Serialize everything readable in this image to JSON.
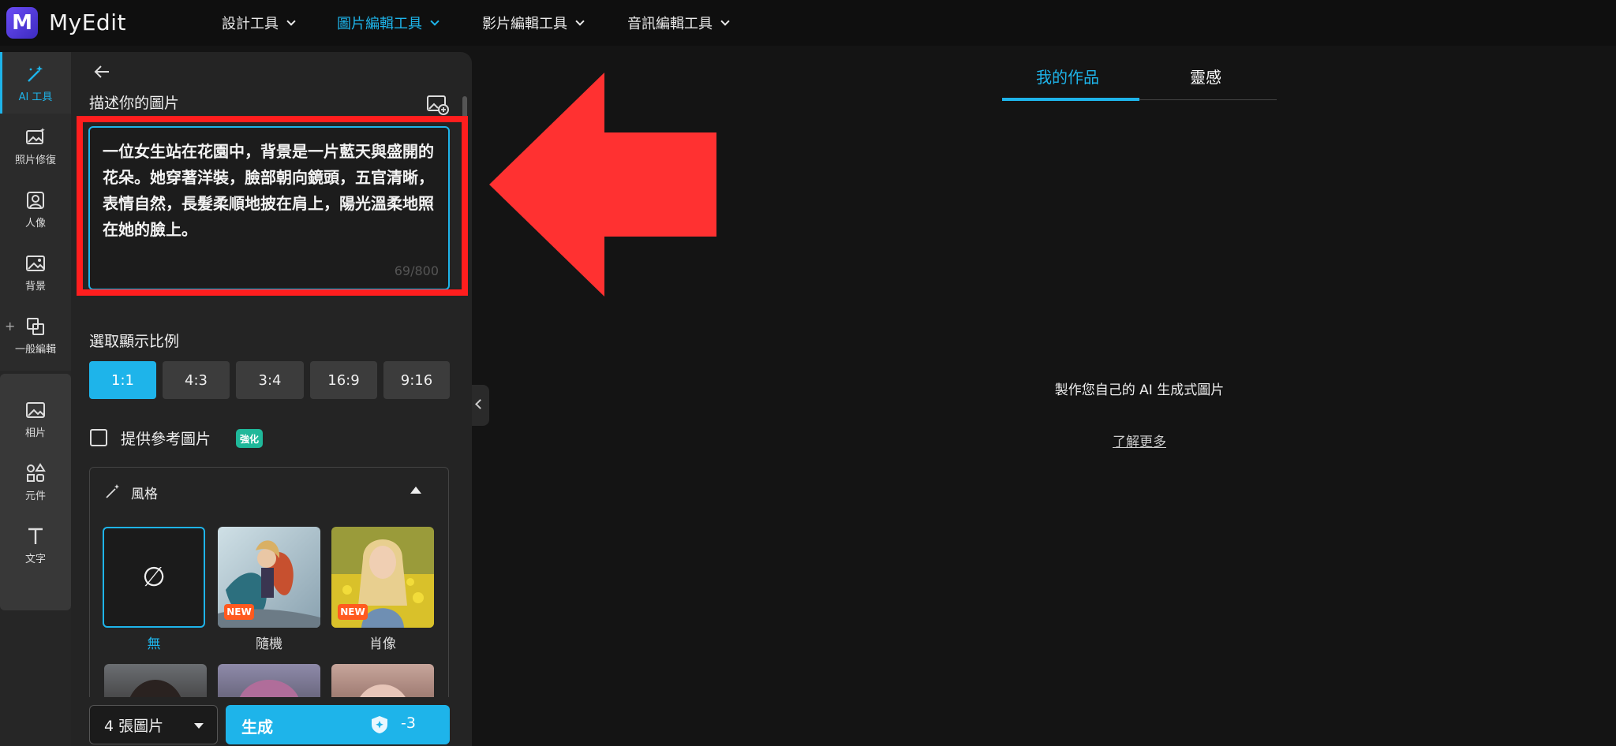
{
  "app": {
    "brand": "MyEdit",
    "logo_letter": "M",
    "accent": "#1eb4ea"
  },
  "topnav": [
    {
      "label": "設計工具",
      "active": false
    },
    {
      "label": "圖片編輯工具",
      "active": true
    },
    {
      "label": "影片編輯工具",
      "active": false
    },
    {
      "label": "音訊編輯工具",
      "active": false
    }
  ],
  "rail": {
    "items": [
      {
        "label": "AI 工具",
        "icon": "magic-wand-icon",
        "active": true
      },
      {
        "label": "照片修復",
        "icon": "photo-sparkle-icon"
      },
      {
        "label": "人像",
        "icon": "portrait-icon"
      },
      {
        "label": "背景",
        "icon": "background-icon"
      },
      {
        "label": "一般編輯",
        "icon": "crop-icon"
      },
      {
        "label": "相片",
        "icon": "photo-icon"
      },
      {
        "label": "元件",
        "icon": "shapes-icon"
      },
      {
        "label": "文字",
        "icon": "text-icon"
      }
    ],
    "plus": "+"
  },
  "panel": {
    "describe_label": "描述你的圖片",
    "prompt_text": "一位女生站在花園中，背景是一片藍天與盛開的花朵。她穿著洋裝，臉部朝向鏡頭，五官清晰，表情自然，長髮柔順地披在肩上，陽光溫柔地照在她的臉上。",
    "char_counter": "69/800",
    "ratio_label": "選取顯示比例",
    "ratios": [
      "1:1",
      "4:3",
      "3:4",
      "16:9",
      "9:16"
    ],
    "selected_ratio": "1:1",
    "reference_label": "提供參考圖片",
    "reference_badge": "強化",
    "style_label": "風格",
    "styles": [
      {
        "label": "無",
        "glyph": "∅",
        "selected": true
      },
      {
        "label": "隨機",
        "badge": "NEW"
      },
      {
        "label": "肖像",
        "badge": "NEW"
      }
    ],
    "image_count": "4 張圖片",
    "generate_label": "生成",
    "credit": "-3"
  },
  "main": {
    "tabs": [
      "我的作品",
      "靈感"
    ],
    "active_tab": "我的作品",
    "empty_title": "製作您自己的 AI 生成式圖片",
    "learn_more": "了解更多"
  }
}
